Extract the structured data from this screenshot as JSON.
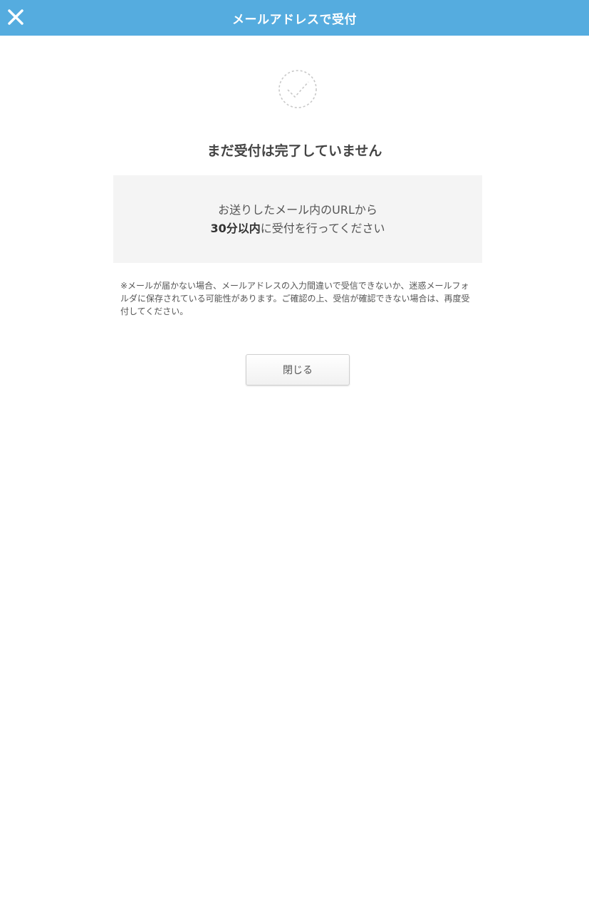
{
  "header": {
    "title": "メールアドレスで受付",
    "close_icon": "close-icon",
    "background_color": "#55acdf"
  },
  "status": {
    "icon": "check-circle-icon",
    "title": "まだ受付は完了していません"
  },
  "info_box": {
    "line1": "お送りしたメール内のURLから",
    "line2_bold": "30分以内",
    "line2_rest": "に受付を行ってください"
  },
  "note": {
    "text": "※メールが届かない場合、メールアドレスの入力間違いで受信できないか、迷惑メールフォルダに保存されている可能性があります。ご確認の上、受信が確認できない場合は、再度受付してください。"
  },
  "close_button": {
    "label": "閉じる"
  }
}
